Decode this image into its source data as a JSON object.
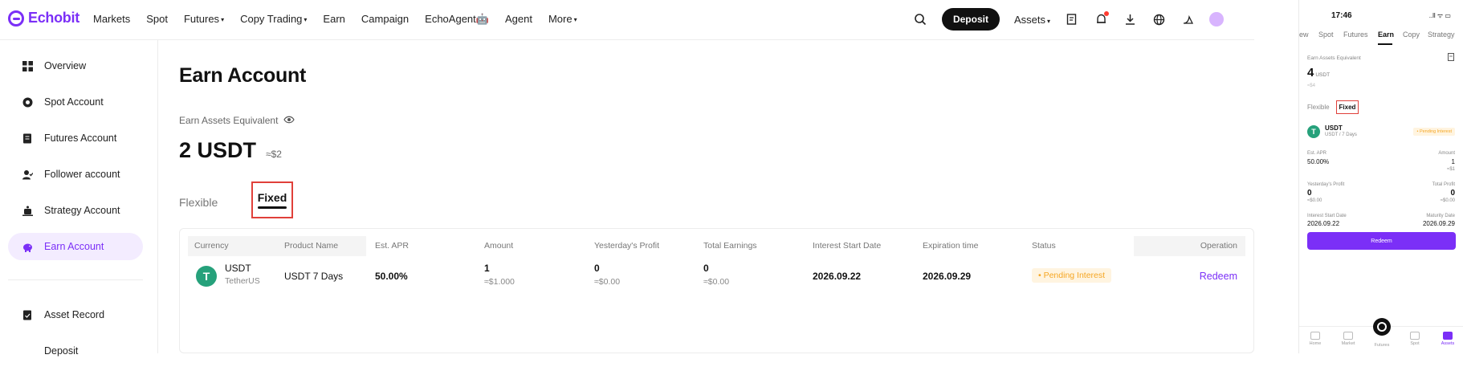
{
  "brand": {
    "name": "Echobit",
    "accent": "#7b2ff7"
  },
  "nav": [
    {
      "label": "Markets"
    },
    {
      "label": "Spot"
    },
    {
      "label": "Futures",
      "caret": "▾"
    },
    {
      "label": "Copy Trading",
      "caret": "▾"
    },
    {
      "label": "Earn"
    },
    {
      "label": "Campaign"
    },
    {
      "label": "EchoAgent🤖"
    },
    {
      "label": "Agent"
    },
    {
      "label": "More",
      "caret": "▾"
    }
  ],
  "topright": {
    "deposit": "Deposit",
    "assets": "Assets",
    "assets_caret": "▾"
  },
  "sidebar": {
    "items": [
      {
        "label": "Overview",
        "icon": "grid-icon"
      },
      {
        "label": "Spot Account",
        "icon": "spot-icon"
      },
      {
        "label": "Futures Account",
        "icon": "futures-icon"
      },
      {
        "label": "Follower account",
        "icon": "follower-icon"
      },
      {
        "label": "Strategy Account",
        "icon": "strategy-icon"
      },
      {
        "label": "Earn Account",
        "icon": "piggy-icon",
        "active": true
      },
      {
        "label": "Asset Record",
        "icon": "record-icon"
      },
      {
        "label": "Deposit",
        "icon": ""
      }
    ]
  },
  "main": {
    "title": "Earn Account",
    "equiv_label": "Earn Assets Equivalent",
    "equiv_value": "2 USDT",
    "equiv_usd": "≈$2",
    "tabs": {
      "flexible": "Flexible",
      "fixed": "Fixed"
    }
  },
  "table": {
    "headers": [
      "Currency",
      "Product Name",
      "Est. APR",
      "Amount",
      "Yesterday's Profit",
      "Total Earnings",
      "Interest Start Date",
      "Expiration time",
      "Status",
      "Operation"
    ],
    "row": {
      "coin_symbol": "T",
      "coin": "USDT",
      "coin_name": "TetherUS",
      "product": "USDT 7 Days",
      "apr": "50.00%",
      "amount": "1",
      "amount_usd": "≈$1.000",
      "y_profit": "0",
      "y_profit_usd": "≈$0.00",
      "total": "0",
      "total_usd": "≈$0.00",
      "start": "2026.09.22",
      "expire": "2026.09.29",
      "status": "• Pending Interest",
      "operation": "Redeem"
    }
  },
  "mobile": {
    "time": "17:46",
    "sys": "..ll ᯤ ▭",
    "tabs": [
      "ew",
      "Spot",
      "Futures",
      "Earn",
      "Copy",
      "Strategy"
    ],
    "label": "Earn Assets Equivalent",
    "value": "4",
    "unit": "USDT",
    "usd": "≈$4",
    "flexible": "Flexible",
    "fixed": "Fixed",
    "coin": "USDT",
    "coin_sub": "USDT / 7 Days",
    "pending": "• Pending Interest",
    "apr_label": "Est. APR",
    "apr": "50.00%",
    "amount_label": "Amount",
    "amount": "1",
    "amount_usd": "≈$1",
    "yp_label": "Yesterday's Profit",
    "yp": "0",
    "yp_usd": "≈$0.00",
    "tp_label": "Total Profit",
    "tp": "0",
    "tp_usd": "≈$0.00",
    "start_label": "Interest Start Date",
    "start": "2026.09.22",
    "maturity_label": "Maturity Date",
    "maturity": "2026.09.29",
    "redeem": "Redeem",
    "bottom": [
      "Home",
      "Market",
      "Futures",
      "Spot",
      "Assets"
    ]
  }
}
